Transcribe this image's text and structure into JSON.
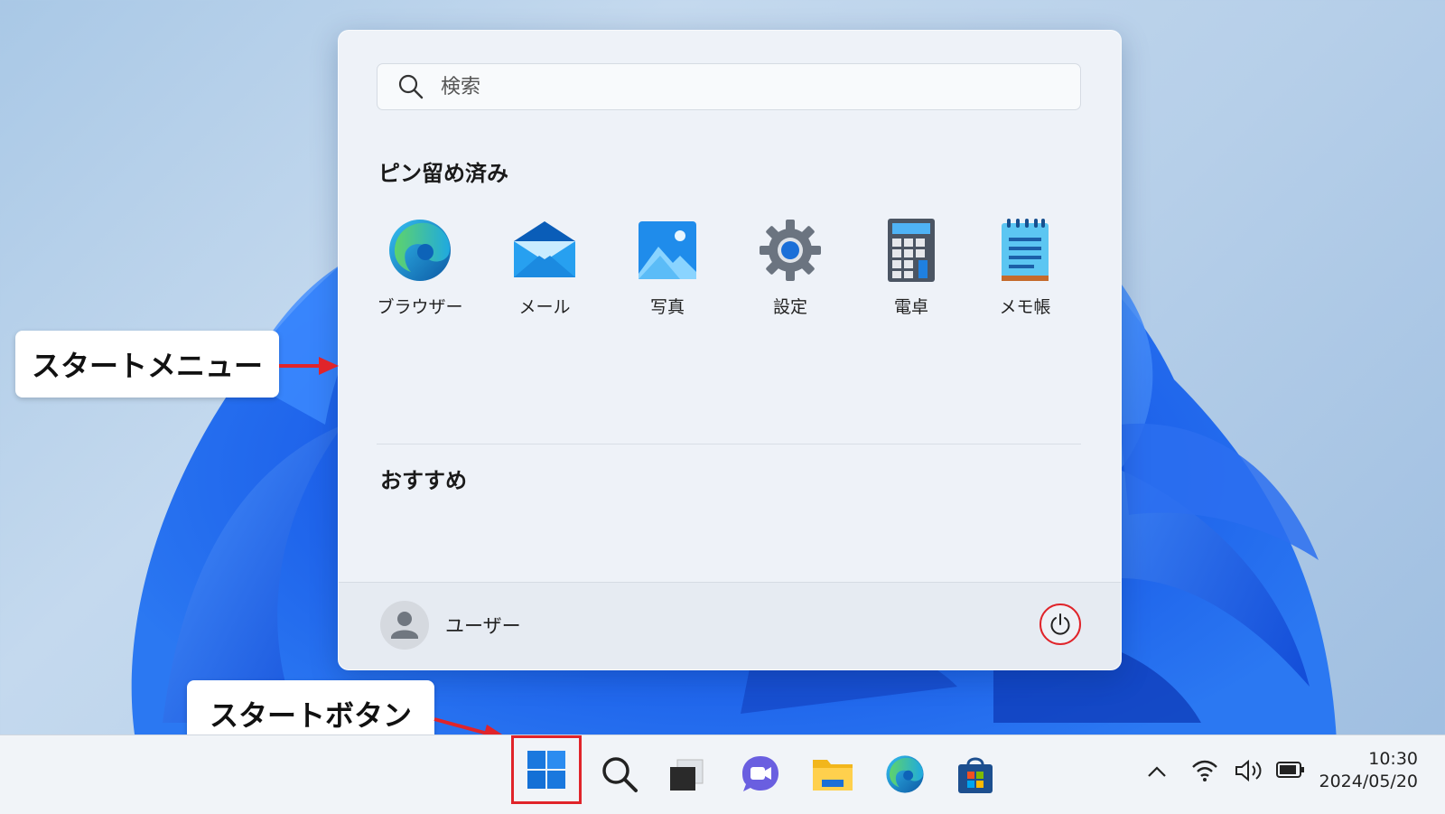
{
  "start_menu": {
    "search": {
      "placeholder": "検索",
      "icon": "search-icon"
    },
    "pinned_title": "ピン留め済み",
    "pinned_apps": [
      {
        "label": "ブラウザー",
        "icon": "edge-icon"
      },
      {
        "label": "メール",
        "icon": "mail-icon"
      },
      {
        "label": "写真",
        "icon": "photos-icon"
      },
      {
        "label": "設定",
        "icon": "settings-icon"
      },
      {
        "label": "電卓",
        "icon": "calculator-icon"
      },
      {
        "label": "メモ帳",
        "icon": "notepad-icon"
      }
    ],
    "recommended_title": "おすすめ",
    "user": {
      "name": "ユーザー",
      "icon": "avatar-icon"
    },
    "power_icon": "power-icon"
  },
  "callouts": {
    "start_menu_label": "スタートメニュー",
    "start_button_label": "スタートボタン"
  },
  "taskbar": {
    "icons": [
      "windows-start-icon",
      "search-icon",
      "task-view-icon",
      "chat-icon",
      "file-explorer-icon",
      "edge-icon",
      "store-icon"
    ],
    "tray": [
      "chevron-up-icon",
      "wifi-icon",
      "volume-icon",
      "battery-icon"
    ],
    "clock": {
      "time": "10:30",
      "date": "2024/05/20"
    }
  },
  "colors": {
    "highlight": "#e0242a",
    "accent": "#0a6fd6"
  }
}
